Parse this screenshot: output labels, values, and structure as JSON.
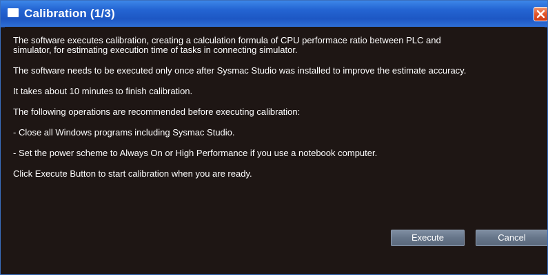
{
  "window": {
    "title": "Calibration (1/3)",
    "close_icon": "close-x-icon",
    "title_icon": "window-icon"
  },
  "message": {
    "p1": "The software executes calibration, creating a calculation formula of CPU performace ratio between PLC and\nsimulator, for estimating execution time of tasks in connecting simulator.",
    "p2": "The software needs to be executed only once after Sysmac Studio was installed to improve the estimate accuracy.",
    "p3": "It takes about 10 minutes to finish calibration.",
    "p4": "The following operations are recommended before executing calibration:",
    "p5": "- Close all Windows programs including Sysmac Studio.",
    "p6": "- Set the power scheme to Always On or High Performance if you use a notebook computer.",
    "p7": "Click Execute Button to start calibration when you are ready."
  },
  "buttons": {
    "execute": "Execute",
    "cancel": "Cancel"
  },
  "colors": {
    "titlebar": "#2464d2",
    "background": "#1e1614",
    "text": "#ffffff",
    "close_button": "#e2552b",
    "button": "#667589"
  }
}
